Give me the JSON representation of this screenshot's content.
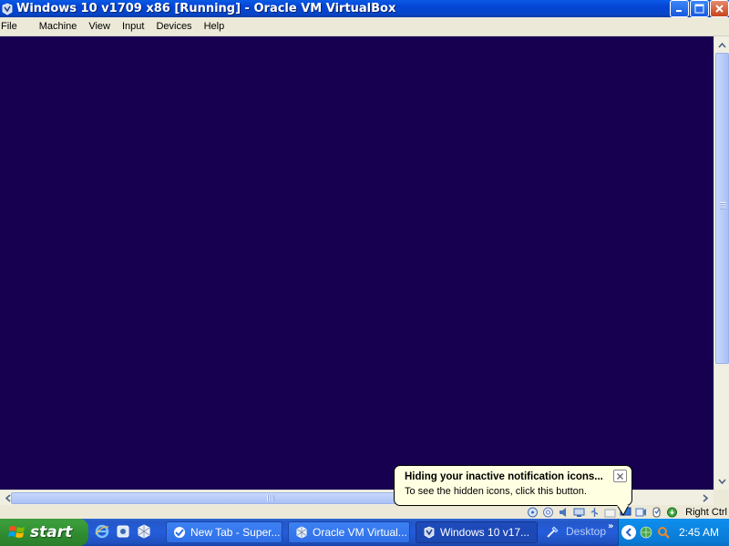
{
  "window": {
    "title": "Windows 10 v1709 x86 [Running] - Oracle VM VirtualBox",
    "app_icon": "virtualbox-vm-icon",
    "controls": [
      "minimize",
      "maximize",
      "close"
    ]
  },
  "menubar": {
    "items": [
      "File",
      "Machine",
      "View",
      "Input",
      "Devices",
      "Help"
    ]
  },
  "vm_display": {
    "background": "#170050"
  },
  "statusbar": {
    "icons": [
      "hard-disk-icon",
      "optical-drive-icon",
      "audio-icon",
      "network-icon",
      "usb-icon",
      "shared-folders-icon",
      "display-icon",
      "video-capture-icon",
      "mouse-integration-icon",
      "keyboard-icon"
    ],
    "host_key": "Right Ctrl"
  },
  "taskbar": {
    "start_label": "start",
    "quick_launch": [
      "internet-explorer-icon",
      "media-player-icon",
      "virtualbox-icon"
    ],
    "tasks": [
      {
        "label": "New Tab - Super...",
        "icon": "browser-icon",
        "active": false
      },
      {
        "label": "Oracle VM Virtual...",
        "icon": "virtualbox-icon",
        "active": false
      },
      {
        "label": "Windows 10 v17...",
        "icon": "virtualbox-vm-icon",
        "active": true
      }
    ],
    "desktop_toolbar": "Desktop",
    "clock": "2:45 AM"
  },
  "balloon": {
    "title": "Hiding your inactive notification icons...",
    "text": "To see the hidden icons, click this button."
  }
}
